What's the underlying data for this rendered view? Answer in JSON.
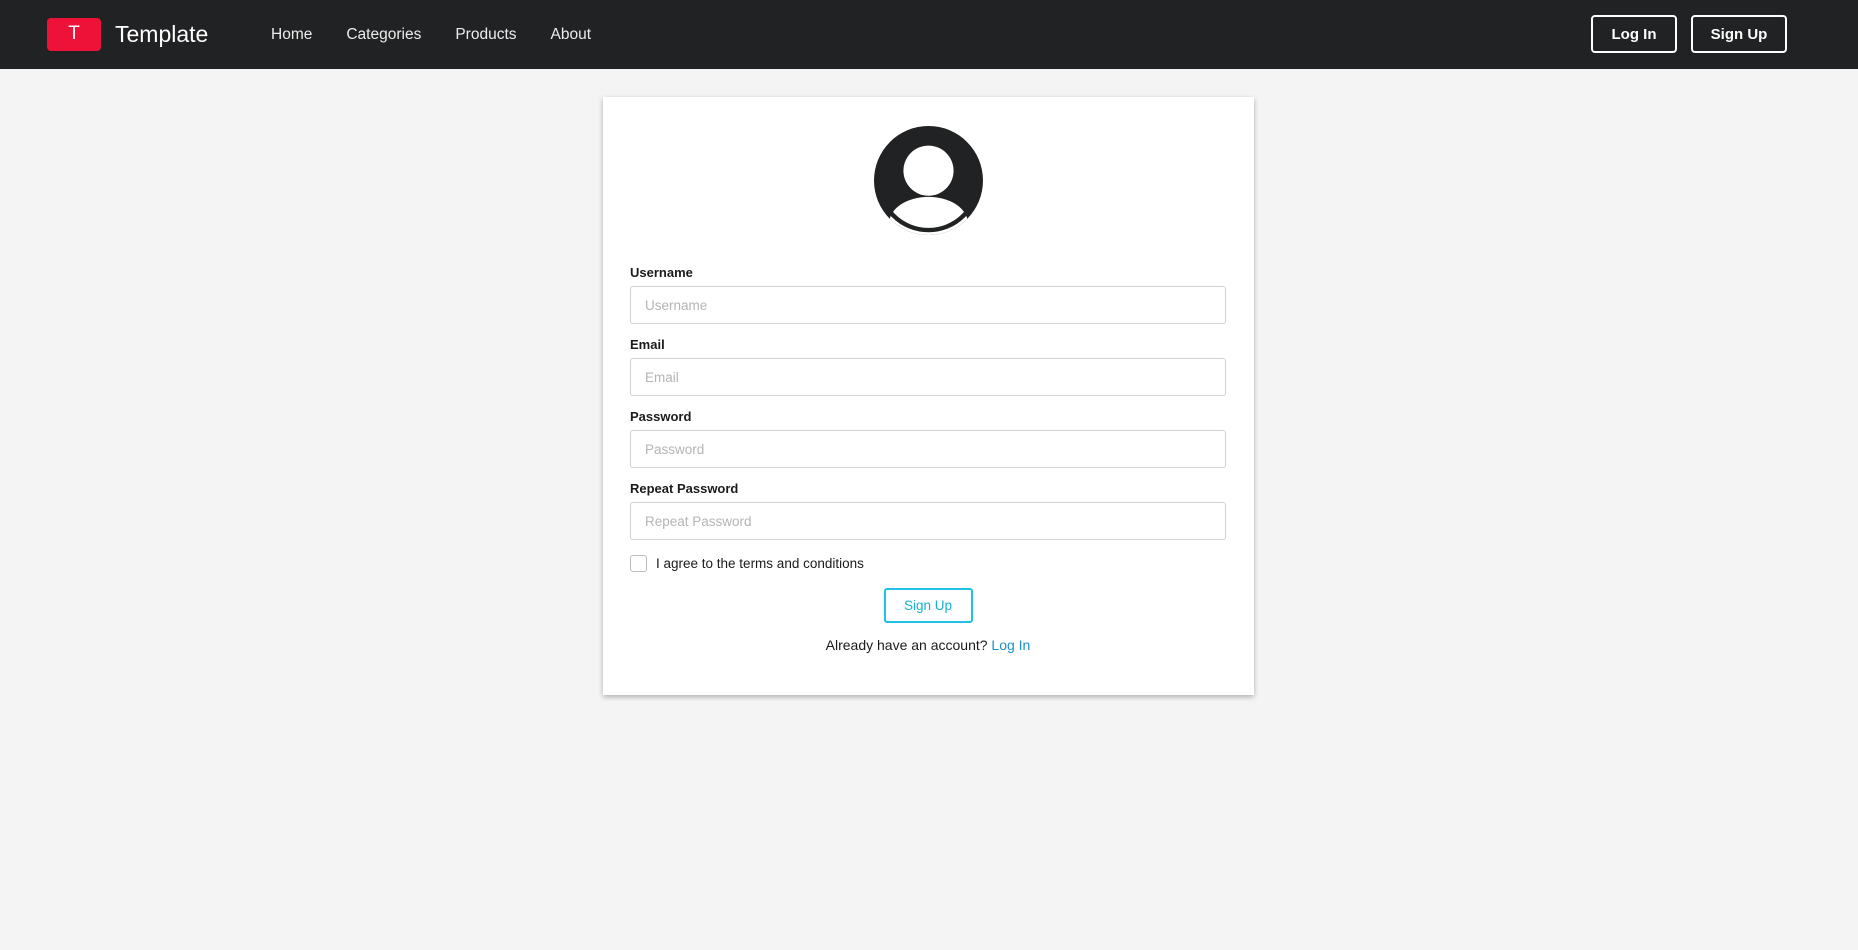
{
  "brand": {
    "mark": "T",
    "name": "Template"
  },
  "nav": {
    "links": [
      {
        "label": "Home"
      },
      {
        "label": "Categories"
      },
      {
        "label": "Products"
      },
      {
        "label": "About"
      }
    ],
    "login_label": "Log In",
    "signup_label": "Sign Up"
  },
  "form": {
    "avatar_icon": "user-circle-icon",
    "fields": [
      {
        "label": "Username",
        "placeholder": "Username",
        "value": ""
      },
      {
        "label": "Email",
        "placeholder": "Email",
        "value": ""
      },
      {
        "label": "Password",
        "placeholder": "Password",
        "value": ""
      },
      {
        "label": "Repeat Password",
        "placeholder": "Repeat Password",
        "value": ""
      }
    ],
    "terms_label": "I agree to the terms and conditions",
    "terms_checked": false,
    "submit_label": "Sign Up",
    "login_prompt": "Already have an account?",
    "login_link": "Log In"
  },
  "colors": {
    "navbar": "#212223",
    "brand_accent": "#ee1238",
    "page_background": "#f4f4f4",
    "submit_accent": "#1fc2e6",
    "link": "#1d8fd1"
  }
}
